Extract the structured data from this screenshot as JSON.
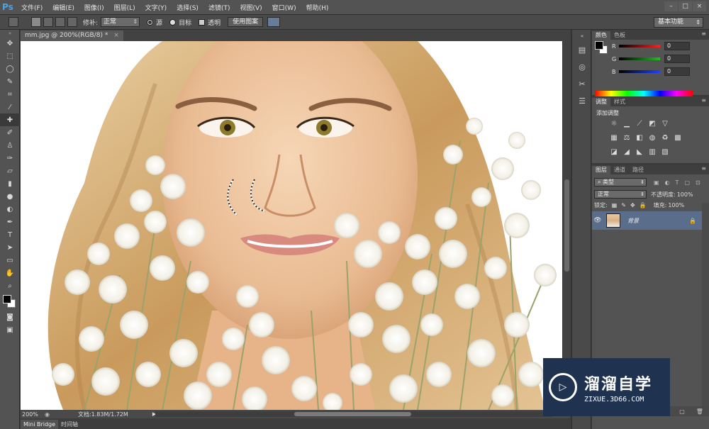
{
  "app": {
    "logo": "Ps"
  },
  "menu": [
    "文件(F)",
    "编辑(E)",
    "图像(I)",
    "图层(L)",
    "文字(Y)",
    "选择(S)",
    "滤镜(T)",
    "视图(V)",
    "窗口(W)",
    "帮助(H)"
  ],
  "window_controls": [
    "–",
    "□",
    "×"
  ],
  "options": {
    "patch_label": "修补:",
    "patch_mode": "正常",
    "source_label": "源",
    "target_label": "目标",
    "transparent_label": "透明",
    "use_pattern": "使用图案",
    "workspace": "基本功能"
  },
  "document": {
    "tab_title": "mm.jpg @ 200%(RGB/8) *",
    "close": "×"
  },
  "status": {
    "zoom": "200%",
    "doc_info": "文档:1.83M/1.72M"
  },
  "bottom_tabs": [
    "Mini Bridge",
    "时间轴"
  ],
  "color_panel": {
    "tabs": [
      "颜色",
      "色板"
    ],
    "channels": [
      {
        "label": "R",
        "value": "0",
        "color": "#ff2020"
      },
      {
        "label": "G",
        "value": "0",
        "color": "#20c020"
      },
      {
        "label": "B",
        "value": "0",
        "color": "#2040ff"
      }
    ]
  },
  "adjust_panel": {
    "tabs": [
      "调整",
      "样式"
    ],
    "title": "添加调整"
  },
  "layers_panel": {
    "tabs": [
      "图层",
      "通道",
      "路径"
    ],
    "kind": "类型",
    "blend_mode": "正常",
    "opacity_label": "不透明度:",
    "opacity": "100%",
    "lock_label": "锁定:",
    "fill_label": "填充:",
    "fill": "100%",
    "layer_name": "背景"
  },
  "watermark": {
    "name": "溜溜自学",
    "url": "ZIXUE.3D66.COM"
  },
  "colors": {
    "canvas_bg": "#ffffff",
    "hair": "#d9b47f",
    "skin": "#f1c9a5",
    "flowers": "#ffffff",
    "stems": "#9aa36b",
    "selected_layer": "#5a6d8a"
  }
}
